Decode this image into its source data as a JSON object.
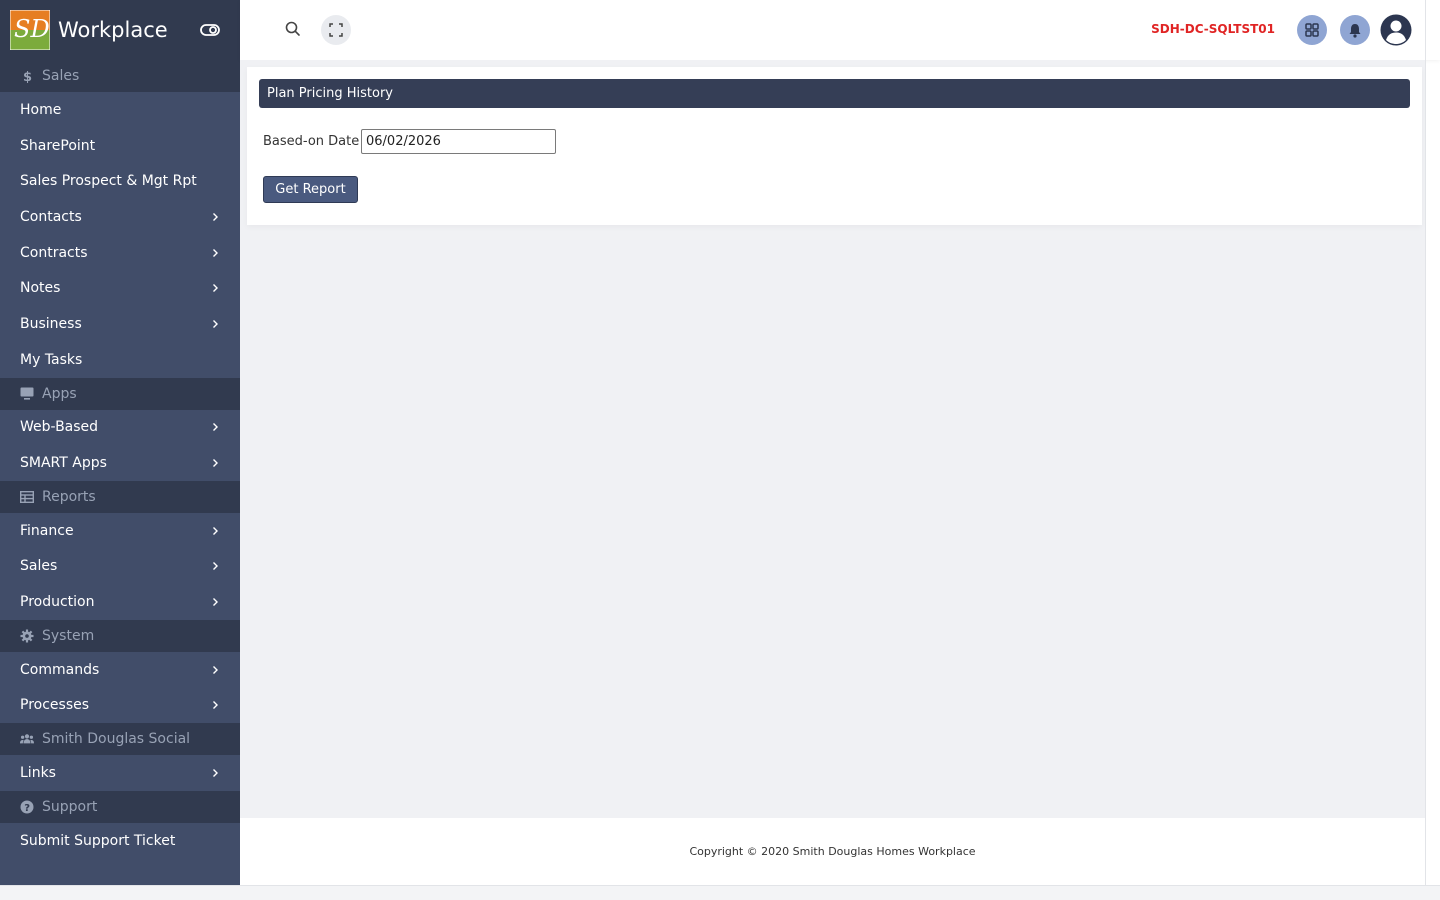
{
  "app": {
    "title": "Workplace",
    "logo_text": "SD"
  },
  "sidebar": {
    "sections": [
      {
        "label": "Sales",
        "icon": "dollar-icon",
        "items": [
          {
            "label": "Home",
            "has_children": false
          },
          {
            "label": "SharePoint",
            "has_children": false
          },
          {
            "label": "Sales Prospect & Mgt Rpt",
            "has_children": false
          },
          {
            "label": "Contacts",
            "has_children": true
          },
          {
            "label": "Contracts",
            "has_children": true
          },
          {
            "label": "Notes",
            "has_children": true
          },
          {
            "label": "Business",
            "has_children": true
          },
          {
            "label": "My Tasks",
            "has_children": false
          }
        ]
      },
      {
        "label": "Apps",
        "icon": "monitor-icon",
        "items": [
          {
            "label": "Web-Based",
            "has_children": true
          },
          {
            "label": "SMART Apps",
            "has_children": true
          }
        ]
      },
      {
        "label": "Reports",
        "icon": "table-icon",
        "items": [
          {
            "label": "Finance",
            "has_children": true
          },
          {
            "label": "Sales",
            "has_children": true
          },
          {
            "label": "Production",
            "has_children": true
          }
        ]
      },
      {
        "label": "System",
        "icon": "gear-icon",
        "items": [
          {
            "label": "Commands",
            "has_children": true
          },
          {
            "label": "Processes",
            "has_children": true
          }
        ]
      },
      {
        "label": "Smith Douglas Social",
        "icon": "users-icon",
        "items": [
          {
            "label": "Links",
            "has_children": true
          }
        ]
      },
      {
        "label": "Support",
        "icon": "question-circle-icon",
        "items": [
          {
            "label": "Submit Support Ticket",
            "has_children": false
          }
        ]
      }
    ]
  },
  "topbar": {
    "server_name": "SDH-DC-SQLTST01"
  },
  "main": {
    "card_title": "Plan Pricing History",
    "date_label": "Based-on Date",
    "date_value": "06/02/2026",
    "button_label": "Get Report"
  },
  "footer": {
    "copyright": "Copyright © 2020 Smith Douglas Homes Workplace"
  },
  "colors": {
    "sidebar_bg": "#414d69",
    "section_bg": "#313a4f",
    "header_bg": "#353e56",
    "server_text": "#e02424",
    "icon_circle": "#8fa5d3"
  }
}
